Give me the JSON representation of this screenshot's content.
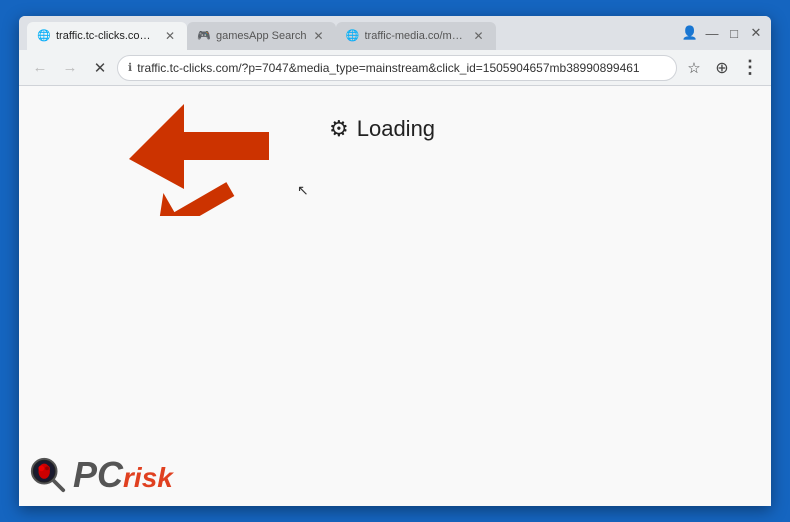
{
  "browser": {
    "tabs": [
      {
        "id": "tab1",
        "label": "traffic.tc-clicks.com/p=...",
        "active": true,
        "favicon": "globe"
      },
      {
        "id": "tab2",
        "label": "gamesApp Search",
        "active": false,
        "favicon": "games"
      },
      {
        "id": "tab3",
        "label": "traffic-media.co/mg14S...",
        "active": false,
        "favicon": "globe"
      }
    ],
    "window_controls": {
      "profile_icon": "👤",
      "minimize": "—",
      "maximize": "□",
      "close": "✕"
    },
    "toolbar": {
      "back_disabled": true,
      "forward_disabled": true,
      "refresh_label": "✕",
      "address": "traffic.tc-clicks.com/?p=7047&media_type=mainstream&click_id=1505904657mb38990899461",
      "bookmark_icon": "☆",
      "extensions_icon": "⊕",
      "menu_icon": "⋮"
    }
  },
  "page": {
    "loading_text": "Loading",
    "gear_char": "⚙"
  },
  "watermark": {
    "pc_text": "PC",
    "risk_text": "risk"
  }
}
